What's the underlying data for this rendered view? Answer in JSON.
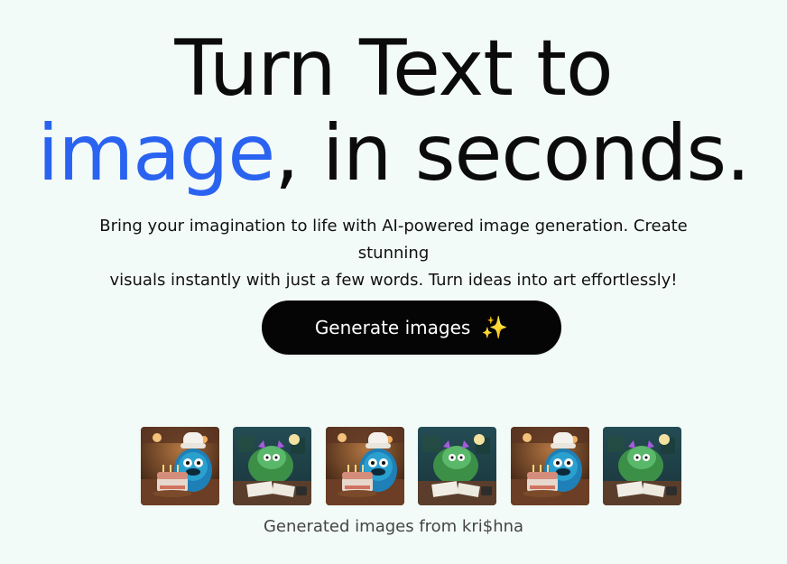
{
  "hero": {
    "headline_line1": "Turn Text to",
    "headline_accent": "image",
    "headline_rest": ", in seconds.",
    "subtitle_line1": "Bring your imagination to life with AI-powered image generation. Create stunning",
    "subtitle_line2": "visuals instantly with just a few words. Turn ideas into art effortlessly!",
    "cta_label": "Generate images",
    "cta_icon": "sparkles-icon"
  },
  "gallery": {
    "images": [
      {
        "variant": "monster-with-cake",
        "icon": "monster-cake-image"
      },
      {
        "variant": "monster-at-desk",
        "icon": "monster-desk-image"
      },
      {
        "variant": "monster-with-cake",
        "icon": "monster-cake-image"
      },
      {
        "variant": "monster-at-desk",
        "icon": "monster-desk-image"
      },
      {
        "variant": "monster-with-cake",
        "icon": "monster-cake-image"
      },
      {
        "variant": "monster-at-desk",
        "icon": "monster-desk-image"
      }
    ],
    "caption": "Generated images from kri$hna"
  },
  "colors": {
    "background": "#f3fbf8",
    "accent": "#2a63f0",
    "button": "#050505",
    "sparkle": "#ffd54a"
  }
}
